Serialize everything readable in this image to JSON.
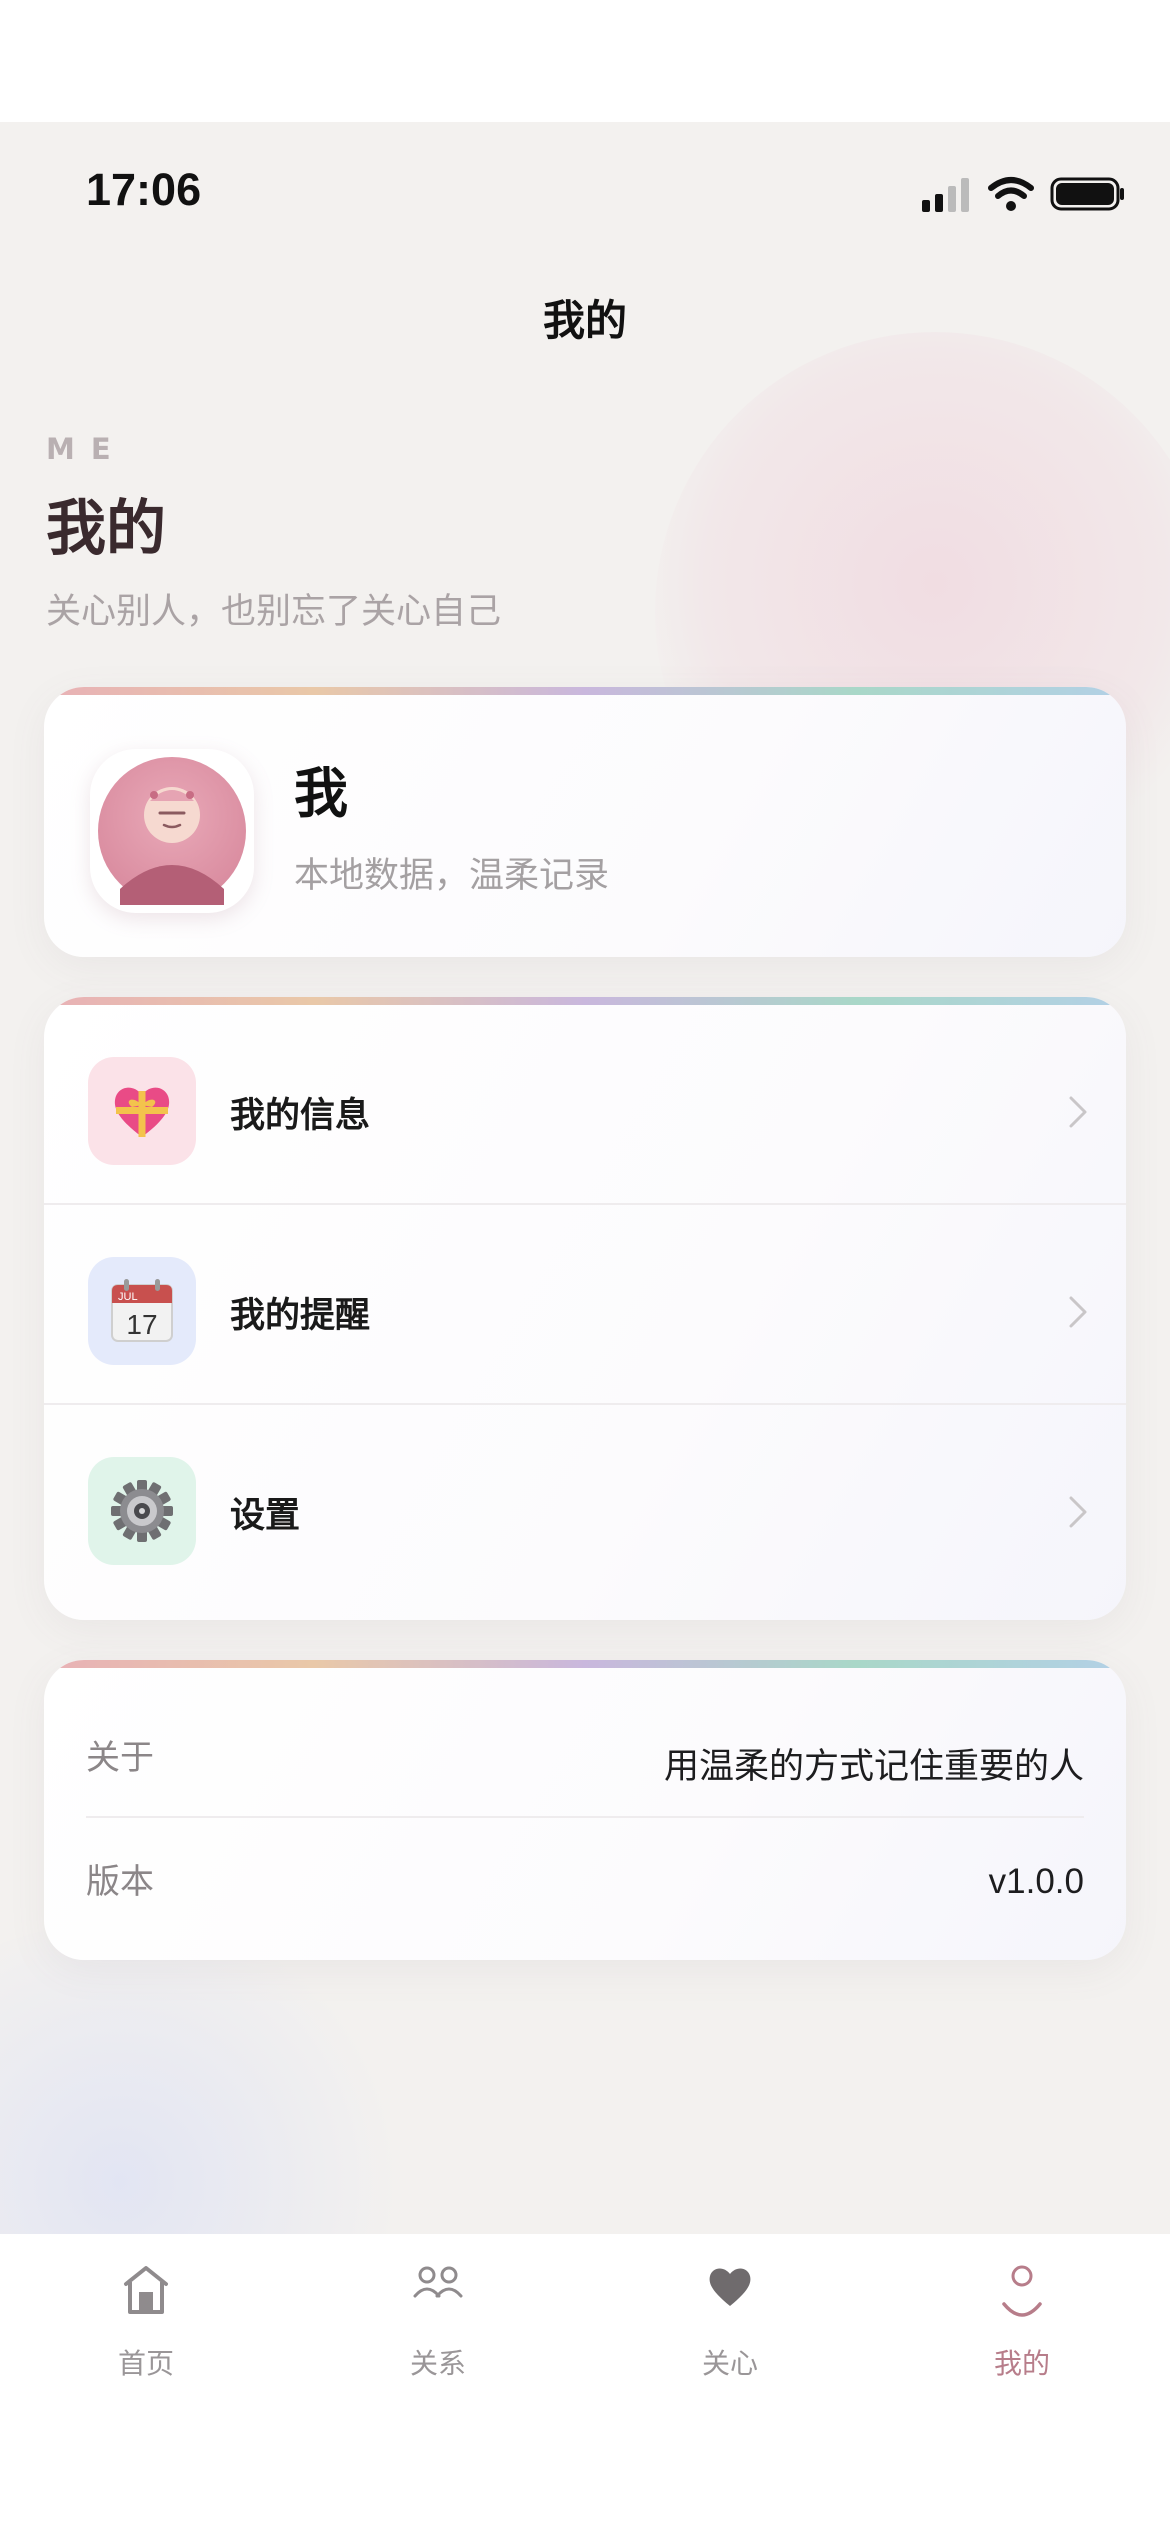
{
  "status_bar": {
    "time": "17:06"
  },
  "nav": {
    "title": "我的"
  },
  "hero": {
    "eyebrow": "ME",
    "title": "我的",
    "subtitle": "关心别人，也别忘了关心自己"
  },
  "profile": {
    "name": "我",
    "subtitle": "本地数据，温柔记录"
  },
  "menu": {
    "items": [
      {
        "label": "我的信息",
        "icon": "heart-gift-icon",
        "icon_bg": "#fbe2e8"
      },
      {
        "label": "我的提醒",
        "icon": "calendar-icon",
        "icon_bg": "#e4eafb",
        "calendar_month": "JUL",
        "calendar_day": "17"
      },
      {
        "label": "设置",
        "icon": "gear-icon",
        "icon_bg": "#e0f4ea"
      }
    ]
  },
  "about": {
    "rows": [
      {
        "key": "关于",
        "value": "用温柔的方式记住重要的人"
      },
      {
        "key": "版本",
        "value": "v1.0.0"
      }
    ]
  },
  "tab_bar": {
    "tabs": [
      {
        "label": "首页",
        "icon": "home-icon"
      },
      {
        "label": "关系",
        "icon": "people-icon"
      },
      {
        "label": "关心",
        "icon": "heart-icon"
      },
      {
        "label": "我的",
        "icon": "profile-icon",
        "active": true
      }
    ]
  },
  "colors": {
    "accent": "#b77d8a",
    "background": "#f3f1ef"
  }
}
